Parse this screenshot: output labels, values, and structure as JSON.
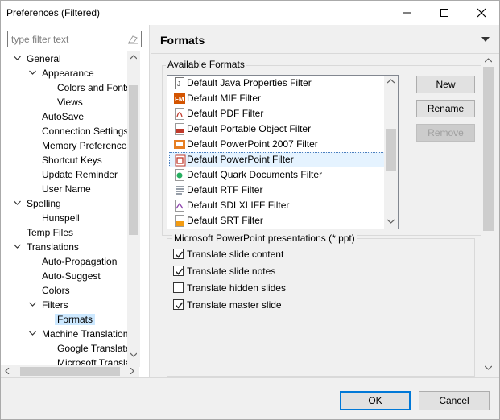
{
  "window": {
    "title": "Preferences (Filtered)"
  },
  "filter": {
    "placeholder": "type filter text"
  },
  "tree": [
    {
      "label": "General",
      "expanded": true
    },
    {
      "label": "Appearance",
      "expanded": true
    },
    {
      "label": "Colors and Fonts"
    },
    {
      "label": "Views"
    },
    {
      "label": "AutoSave"
    },
    {
      "label": "Connection Settings"
    },
    {
      "label": "Memory Preferences"
    },
    {
      "label": "Shortcut Keys"
    },
    {
      "label": "Update Reminder"
    },
    {
      "label": "User Name"
    },
    {
      "label": "Spelling",
      "expanded": true
    },
    {
      "label": "Hunspell"
    },
    {
      "label": "Temp Files"
    },
    {
      "label": "Translations",
      "expanded": true
    },
    {
      "label": "Auto-Propagation"
    },
    {
      "label": "Auto-Suggest"
    },
    {
      "label": "Colors"
    },
    {
      "label": "Filters",
      "expanded": true
    },
    {
      "label": "Formats",
      "selected": true
    },
    {
      "label": "Machine Translation",
      "expanded": true
    },
    {
      "label": "Google Translate"
    },
    {
      "label": "Microsoft Translator"
    }
  ],
  "header": {
    "title": "Formats"
  },
  "formats": {
    "group_label": "Available Formats",
    "items": [
      {
        "label": "Default Java Properties Filter",
        "icon": "java-file-icon"
      },
      {
        "label": "Default MIF Filter",
        "icon": "framemaker-icon"
      },
      {
        "label": "Default PDF Filter",
        "icon": "pdf-file-icon"
      },
      {
        "label": "Default Portable Object Filter",
        "icon": "po-file-icon"
      },
      {
        "label": "Default PowerPoint 2007 Filter",
        "icon": "pptx-file-icon"
      },
      {
        "label": "Default PowerPoint Filter",
        "icon": "ppt-file-icon",
        "selected": true
      },
      {
        "label": "Default Quark Documents Filter",
        "icon": "quark-file-icon"
      },
      {
        "label": "Default RTF Filter",
        "icon": "rtf-file-icon"
      },
      {
        "label": "Default SDLXLIFF Filter",
        "icon": "sdlxliff-file-icon"
      },
      {
        "label": "Default SRT Filter",
        "icon": "srt-file-icon"
      }
    ],
    "buttons": {
      "new": "New",
      "rename": "Rename",
      "remove": "Remove"
    }
  },
  "options": {
    "group_label": "Microsoft PowerPoint presentations (*.ppt)",
    "items": [
      {
        "label": "Translate slide content",
        "checked": true
      },
      {
        "label": "Translate slide notes",
        "checked": true
      },
      {
        "label": "Translate hidden slides",
        "checked": false
      },
      {
        "label": "Translate master slide",
        "checked": true
      }
    ]
  },
  "footer": {
    "ok": "OK",
    "cancel": "Cancel"
  },
  "colors": {
    "selection": "#cce8ff",
    "list_selection": "#e5f3ff",
    "accent": "#0078d7"
  }
}
